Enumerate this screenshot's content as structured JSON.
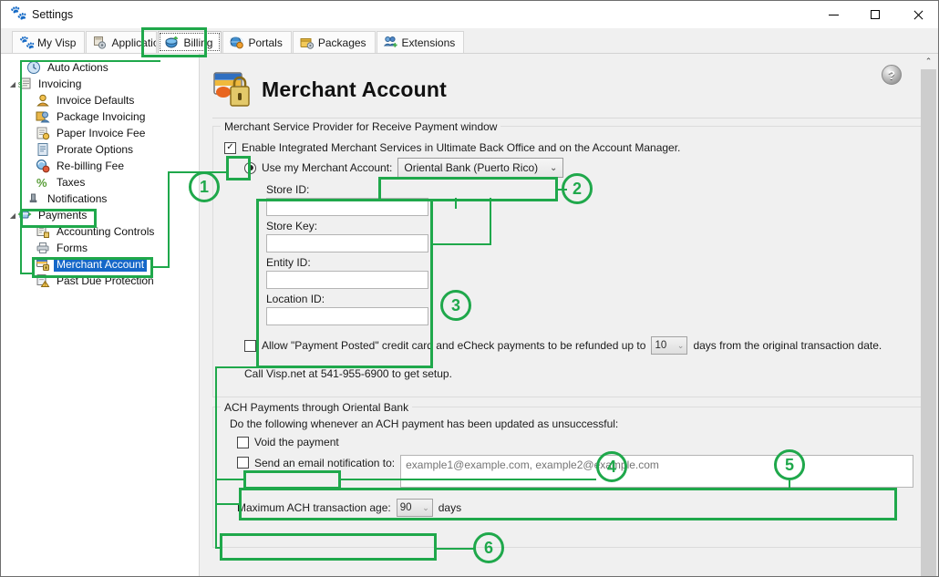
{
  "window": {
    "title": "Settings",
    "icon": "visp-foot-icon",
    "minimize_label": "–",
    "maximize_label": "□",
    "close_label": "✕"
  },
  "tabs": [
    {
      "label": "My Visp",
      "icon": "visp-foot-icon",
      "selected": false
    },
    {
      "label": "Application",
      "icon": "application-icon",
      "selected": false
    },
    {
      "label": "Billing",
      "icon": "billing-icon",
      "selected": true
    },
    {
      "label": "Portals",
      "icon": "portals-icon",
      "selected": false
    },
    {
      "label": "Packages",
      "icon": "packages-icon",
      "selected": false
    },
    {
      "label": "Extensions",
      "icon": "extensions-icon",
      "selected": false
    }
  ],
  "tree": [
    {
      "label": "Auto Actions",
      "indent": 0,
      "expander": "",
      "icon": "clock-icon",
      "selected": false
    },
    {
      "label": "Invoicing",
      "indent": 0,
      "expander": "◢",
      "icon": "invoice-icon",
      "selected": false
    },
    {
      "label": "Invoice Defaults",
      "indent": 1,
      "expander": "",
      "icon": "user-icon",
      "selected": false
    },
    {
      "label": "Package Invoicing",
      "indent": 1,
      "expander": "",
      "icon": "package-user-icon",
      "selected": false
    },
    {
      "label": "Paper Invoice Fee",
      "indent": 1,
      "expander": "",
      "icon": "paper-fee-icon",
      "selected": false
    },
    {
      "label": "Prorate Options",
      "indent": 1,
      "expander": "",
      "icon": "document-icon",
      "selected": false
    },
    {
      "label": "Re-billing Fee",
      "indent": 1,
      "expander": "",
      "icon": "rebill-icon",
      "selected": false
    },
    {
      "label": "Taxes",
      "indent": 1,
      "expander": "",
      "icon": "percent-icon",
      "selected": false
    },
    {
      "label": "Notifications",
      "indent": 0,
      "expander": "",
      "icon": "bell-icon",
      "selected": false
    },
    {
      "label": "Payments",
      "indent": 0,
      "expander": "◢",
      "icon": "payments-icon",
      "selected": false
    },
    {
      "label": "Accounting Controls",
      "indent": 1,
      "expander": "",
      "icon": "accounting-icon",
      "selected": false
    },
    {
      "label": "Forms",
      "indent": 1,
      "expander": "",
      "icon": "printer-icon",
      "selected": false
    },
    {
      "label": "Merchant Account",
      "indent": 1,
      "expander": "",
      "icon": "merchant-icon",
      "selected": true
    },
    {
      "label": "Past Due Protection",
      "indent": 1,
      "expander": "",
      "icon": "past-due-icon",
      "selected": false
    }
  ],
  "page": {
    "title": "Merchant Account",
    "icon": "merchant-card-lock-icon",
    "help_label": "?",
    "scroll_up_label": "⌃"
  },
  "provider_group": {
    "caption": "Merchant Service Provider for Receive Payment window",
    "enable_checkbox": {
      "label": "Enable Integrated Merchant Services in Ultimate Back Office and on the Account Manager.",
      "checked": true,
      "mark": "✓"
    },
    "use_account_radio": {
      "label": "Use my Merchant Account:",
      "selected": true
    },
    "provider_select": {
      "value": "Oriental Bank (Puerto Rico)",
      "chevron": "⌄"
    },
    "fields": [
      {
        "label": "Store ID:",
        "value": ""
      },
      {
        "label": "Store Key:",
        "value": ""
      },
      {
        "label": "Entity ID:",
        "value": ""
      },
      {
        "label": "Location ID:",
        "value": ""
      }
    ],
    "refund_row": {
      "checked": false,
      "text_before": "Allow \"Payment Posted\" credit card and eCheck payments to be refunded up to",
      "days_value": "10",
      "days_chevron": "⌄",
      "text_after": "days from the original transaction date."
    },
    "setup_note": "Call Visp.net at 541-955-6900 to get setup."
  },
  "ach_group": {
    "caption": "ACH Payments through Oriental Bank",
    "intro": "Do the following whenever an ACH payment has been updated as unsuccessful:",
    "void_checkbox": {
      "label": "Void the payment",
      "checked": false
    },
    "email_checkbox": {
      "label": "Send an email notification to:",
      "checked": false
    },
    "email_input": {
      "value": "",
      "placeholder": "example1@example.com, example2@example.com"
    },
    "max_age": {
      "label": "Maximum ACH transaction age:",
      "value": "90",
      "chevron": "⌄",
      "unit": "days"
    }
  },
  "annotations": {
    "accent_color": "#1fa84b",
    "markers": [
      {
        "n": "1"
      },
      {
        "n": "2"
      },
      {
        "n": "3"
      },
      {
        "n": "4"
      },
      {
        "n": "5"
      },
      {
        "n": "6"
      }
    ]
  }
}
